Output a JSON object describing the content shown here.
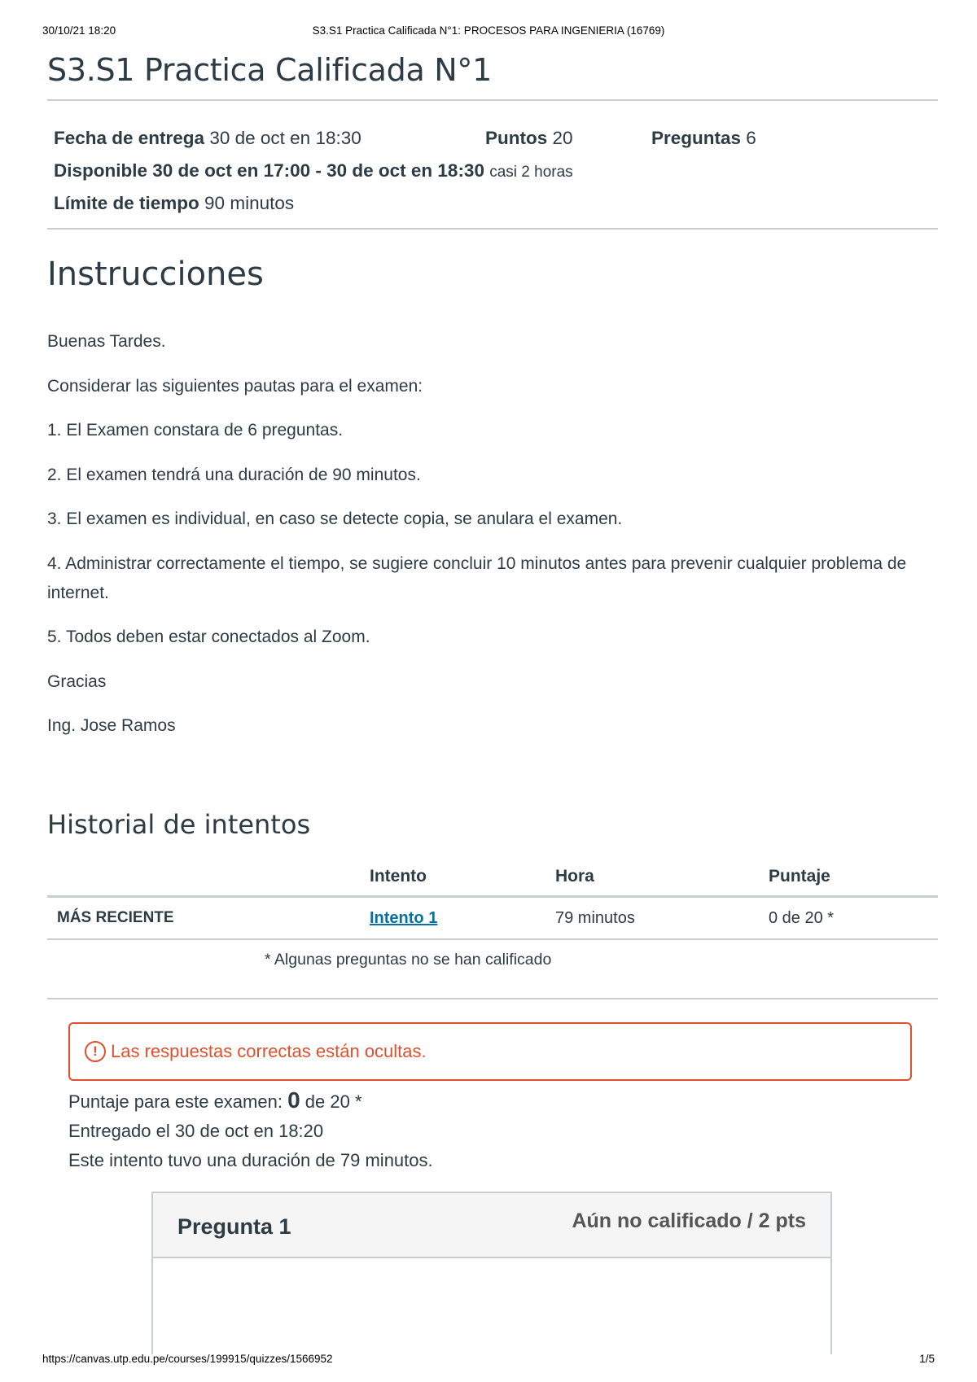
{
  "print_header": {
    "date": "30/10/21 18:20",
    "title": "S3.S1 Practica Calificada N°1: PROCESOS PARA INGENIERIA (16769)"
  },
  "print_footer": {
    "url": "https://canvas.utp.edu.pe/courses/199915/quizzes/1566952",
    "page": "1/5"
  },
  "quiz": {
    "title": "S3.S1 Practica Calificada N°1",
    "due_label": "Fecha de entrega",
    "due_value": "30 de oct en 18:30",
    "points_label": "Puntos",
    "points_value": "20",
    "questions_label": "Preguntas",
    "questions_value": "6",
    "available_label": "Disponible",
    "available_value": "30 de oct en 17:00 - 30 de oct en 18:30",
    "available_note": "casi 2 horas",
    "time_limit_label": "Límite de tiempo",
    "time_limit_value": "90 minutos"
  },
  "instructions": {
    "heading": "Instrucciones",
    "paragraphs": [
      "Buenas Tardes.",
      "Considerar las siguientes pautas para el examen:",
      "1. El Examen constara de 6 preguntas.",
      "2. El examen tendrá una duración de 90 minutos.",
      "3. El examen es individual, en caso se detecte copia, se anulara el examen.",
      "4. Administrar correctamente el tiempo, se sugiere concluir 10 minutos antes para prevenir cualquier problema de internet.",
      "5. Todos deben estar conectados al Zoom.",
      "Gracias",
      "Ing. Jose Ramos"
    ]
  },
  "history": {
    "heading": "Historial de intentos",
    "columns": [
      "",
      "Intento",
      "Hora",
      "Puntaje"
    ],
    "rows": [
      {
        "label": "MÁS RECIENTE",
        "attempt": "Intento 1",
        "time": "79 minutos",
        "score": "0 de 20 *"
      }
    ],
    "footnote": "* Algunas preguntas no se han calificado"
  },
  "alert": {
    "icon": "warning-circle-icon",
    "text": "Las respuestas correctas están ocultas.",
    "color": "#e0502d"
  },
  "score_summary": {
    "score_prefix": "Puntaje para este examen:",
    "score_value": "0",
    "score_suffix": "de 20 *",
    "submitted": "Entregado el 30 de oct en 18:20",
    "duration": "Este intento tuvo una duración de 79 minutos."
  },
  "question": {
    "name": "Pregunta 1",
    "status": "Aún no calificado / 2 pts"
  }
}
